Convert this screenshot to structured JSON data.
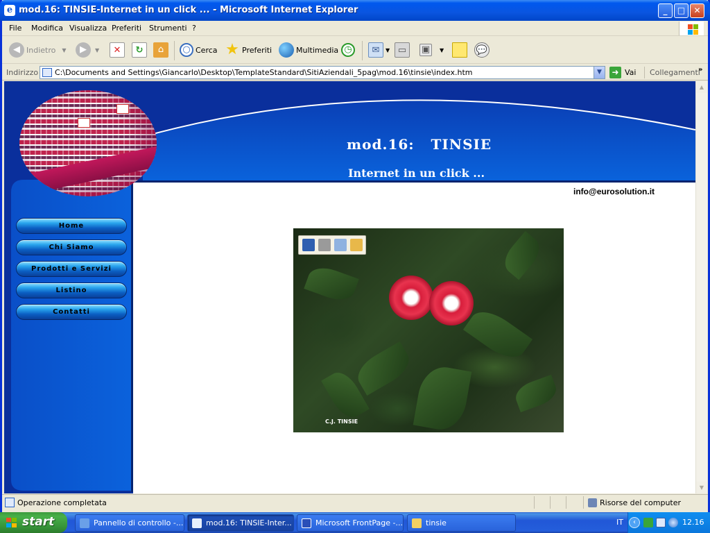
{
  "window": {
    "title": "mod.16: TINSIE-Internet in un click ... - Microsoft Internet Explorer",
    "min_label": "_",
    "max_label": "□",
    "close_label": "✕"
  },
  "menu": {
    "items": [
      "File",
      "Modifica",
      "Visualizza",
      "Preferiti",
      "Strumenti",
      "?"
    ]
  },
  "toolbar": {
    "back_label": "Indietro",
    "search_label": "Cerca",
    "favorites_label": "Preferiti",
    "media_label": "Multimedia"
  },
  "address": {
    "label": "Indirizzo",
    "url": "C:\\Documents and Settings\\Giancarlo\\Desktop\\TemplateStandard\\SitiAziendali_5pag\\mod.16\\tinsie\\index.htm",
    "go_label": "Vai",
    "links_label": "Collegamenti",
    "more_label": "»"
  },
  "page": {
    "title": "mod.16:   TINSIE",
    "subtitle": "Internet in un click ...",
    "email": "info@eurosolution.it",
    "nav": [
      "Home",
      "Chi Siamo",
      "Prodotti e Servizi",
      "Listino",
      "Contatti"
    ],
    "photo_caption": "C.J. TINSIE"
  },
  "status": {
    "text": "Operazione completata",
    "zone": "Risorse del computer"
  },
  "taskbar": {
    "start_label": "start",
    "tasks": [
      {
        "label": "Pannello di controllo -..."
      },
      {
        "label": "mod.16: TINSIE-Inter..."
      },
      {
        "label": "Microsoft FrontPage -..."
      },
      {
        "label": "tinsie"
      }
    ],
    "lang": "IT",
    "clock": "12.16"
  },
  "colors": {
    "site_blue": "#0a5fd8",
    "site_dark_blue": "#0837a8",
    "flower_red": "#d81e3c"
  }
}
